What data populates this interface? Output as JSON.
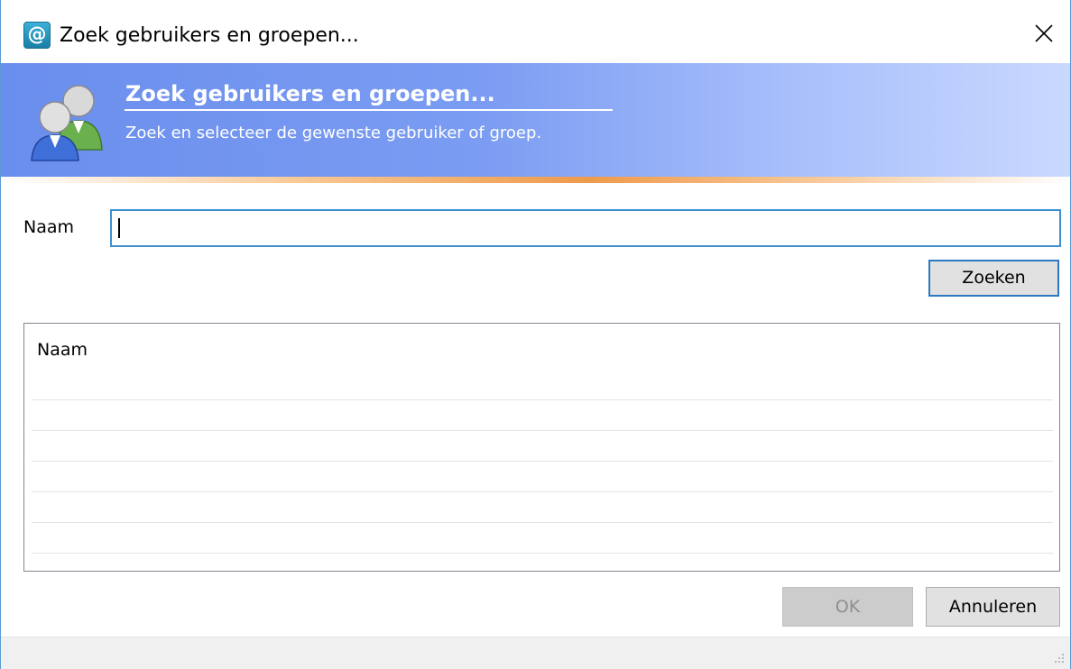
{
  "window": {
    "title": "Zoek gebruikers en groepen...",
    "app_icon_glyph": "@",
    "icons": [
      "at-sign-icon",
      "close-icon",
      "users-icon",
      "resize-grip-icon"
    ]
  },
  "banner": {
    "title": "Zoek gebruikers en groepen...",
    "subtitle": "Zoek en selecteer de gewenste gebruiker of groep."
  },
  "search": {
    "label": "Naam",
    "value": "",
    "button_label": "Zoeken"
  },
  "results": {
    "column_header": "Naam",
    "rows": []
  },
  "footer": {
    "ok_label": "OK",
    "cancel_label": "Annuleren"
  },
  "colors": {
    "accent": "#3d8fcf",
    "banner_start": "#6a8eed",
    "banner_end": "#c9d8fe",
    "accent_orange": "#ee9a4b"
  }
}
